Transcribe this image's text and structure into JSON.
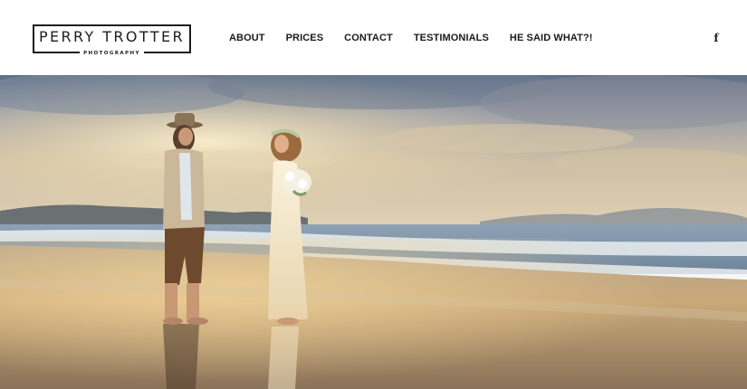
{
  "brand": {
    "name": "PERRY TROTTER",
    "tagline": "PHOTOGRAPHY"
  },
  "nav": {
    "items": [
      {
        "label": "ABOUT"
      },
      {
        "label": "PRICES"
      },
      {
        "label": "CONTACT"
      },
      {
        "label": "TESTIMONIALS"
      },
      {
        "label": "HE SAID WHAT?!"
      }
    ]
  },
  "social": {
    "facebook_glyph": "f",
    "facebook_icon": "facebook-icon"
  },
  "hero": {
    "subject": "couple-on-beach-photo"
  },
  "colors": {
    "text": "#1b1b1b",
    "background": "#ffffff"
  }
}
